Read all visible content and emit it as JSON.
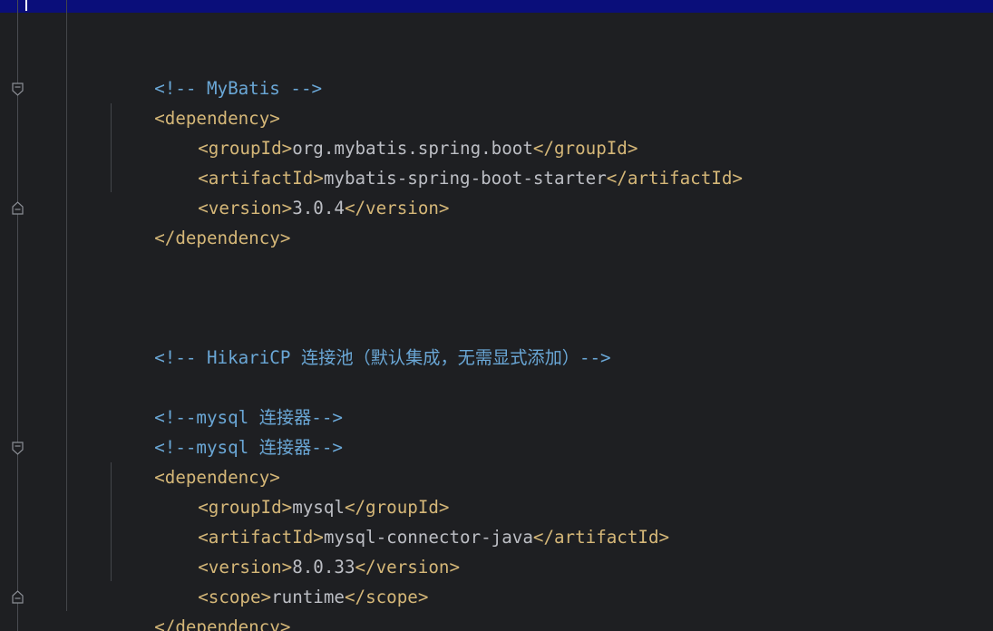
{
  "lines": {
    "l1": {
      "comment": "<!-- MyBatis -->"
    },
    "l2": {
      "tag": "<dependency>"
    },
    "l3": {
      "open": "<groupId>",
      "text": "org.mybatis.spring.boot",
      "close": "</groupId>"
    },
    "l4": {
      "open": "<artifactId>",
      "text": "mybatis-spring-boot-starter",
      "close": "</artifactId>"
    },
    "l5": {
      "open": "<version>",
      "text": "3.0.4",
      "close": "</version>"
    },
    "l6": {
      "tag": "</dependency>"
    },
    "l7": {
      "comment": "<!-- HikariCP 连接池（默认集成，无需显式添加）-->"
    },
    "l8": {
      "comment": "<!--mysql 连接器-->"
    },
    "l9": {
      "comment": "<!--mysql 连接器-->"
    },
    "l10": {
      "tag": "<dependency>"
    },
    "l11": {
      "open": "<groupId>",
      "text": "mysql",
      "close": "</groupId>"
    },
    "l12": {
      "open": "<artifactId>",
      "text": "mysql-connector-java",
      "close": "</artifactId>"
    },
    "l13": {
      "open": "<version>",
      "text": "8.0.33",
      "close": "</version>"
    },
    "l14": {
      "open": "<scope>",
      "text": "runtime",
      "close": "</scope>"
    },
    "l15": {
      "tag": "</dependency>"
    }
  },
  "colors": {
    "background": "#1e1f22",
    "current_line": "#0a0e7a",
    "comment": "#6aa7d6",
    "tag": "#d5b778",
    "text": "#bcbec4"
  }
}
